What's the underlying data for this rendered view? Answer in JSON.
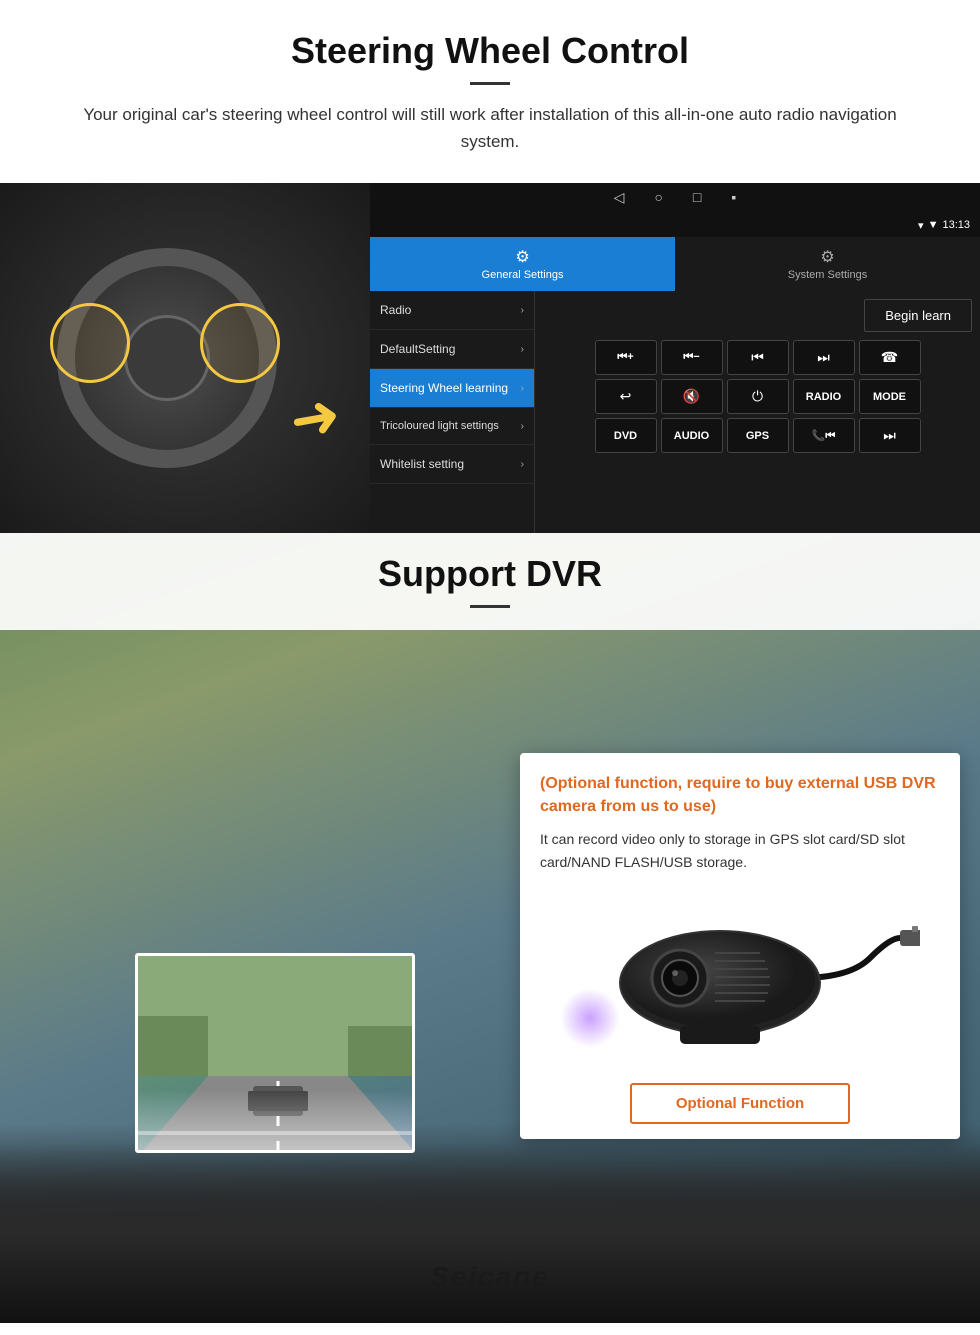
{
  "page": {
    "section1": {
      "title": "Steering Wheel Control",
      "description": "Your original car's steering wheel control will still work after installation of this all-in-one auto radio navigation system.",
      "android_ui": {
        "statusbar": {
          "time": "13:13",
          "signal_icon": "▼",
          "wifi_icon": "▾"
        },
        "navbar": {
          "back": "◁",
          "home": "○",
          "recent": "□",
          "menu": "▪"
        },
        "tabs": {
          "general": {
            "label": "General Settings",
            "icon": "⚙"
          },
          "system": {
            "label": "System Settings",
            "icon": "⚙"
          }
        },
        "menu_items": [
          {
            "label": "Radio",
            "active": false
          },
          {
            "label": "DefaultSetting",
            "active": false
          },
          {
            "label": "Steering Wheel learning",
            "active": true
          },
          {
            "label": "Tricoloured light settings",
            "active": false
          },
          {
            "label": "Whitelist setting",
            "active": false
          }
        ],
        "begin_learn": "Begin learn",
        "control_buttons": {
          "row1": [
            "⏮+",
            "⏮−",
            "⏮",
            "⏭",
            "☎"
          ],
          "row2": [
            "↩",
            "🔇",
            "⏻",
            "RADIO",
            "MODE"
          ],
          "row3": [
            "DVD",
            "AUDIO",
            "GPS",
            "📞⏮",
            "⏭"
          ]
        }
      }
    },
    "section2": {
      "title": "Support DVR",
      "card": {
        "optional_title": "(Optional function, require to buy external USB DVR camera from us to use)",
        "description": "It can record video only to storage in GPS slot card/SD slot card/NAND FLASH/USB storage.",
        "optional_button": "Optional Function"
      },
      "brand": "Seicane"
    }
  }
}
